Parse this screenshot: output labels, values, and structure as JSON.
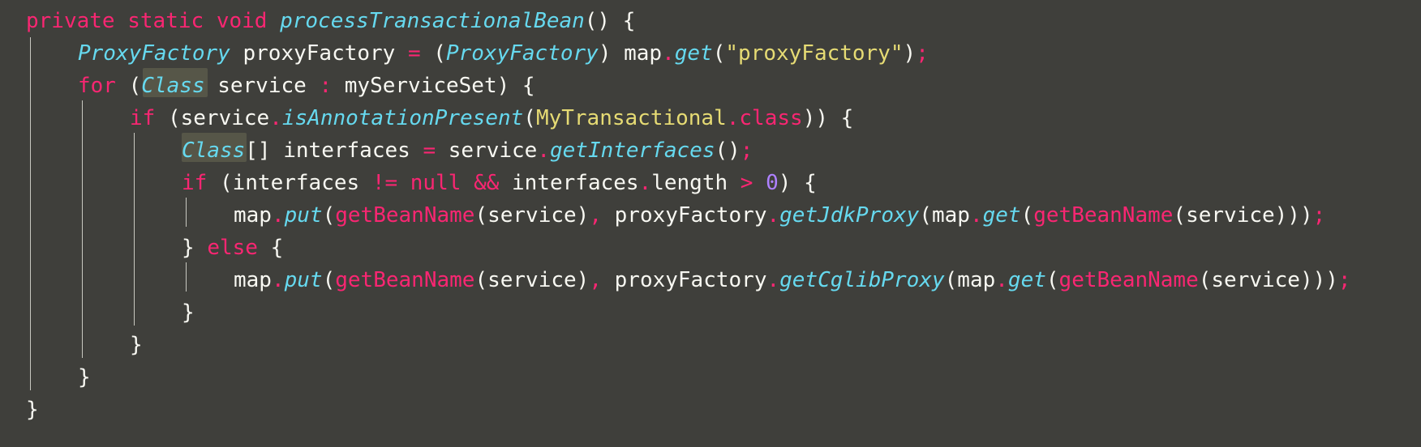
{
  "code_lines": [
    [
      {
        "t": "private",
        "c": "kw"
      },
      {
        "t": " ",
        "c": "pl"
      },
      {
        "t": "static",
        "c": "kw"
      },
      {
        "t": " ",
        "c": "pl"
      },
      {
        "t": "void",
        "c": "kw"
      },
      {
        "t": " ",
        "c": "pl"
      },
      {
        "t": "processTransactionalBean",
        "c": "fn"
      },
      {
        "t": "() {",
        "c": "pl"
      }
    ],
    [
      {
        "t": "ProxyFactory",
        "c": "ty"
      },
      {
        "t": " proxyFactory ",
        "c": "pl"
      },
      {
        "t": "=",
        "c": "op"
      },
      {
        "t": " (",
        "c": "pl"
      },
      {
        "t": "ProxyFactory",
        "c": "ty"
      },
      {
        "t": ") map",
        "c": "pl"
      },
      {
        "t": ".",
        "c": "op"
      },
      {
        "t": "get",
        "c": "fn"
      },
      {
        "t": "(",
        "c": "pl"
      },
      {
        "t": "\"proxyFactory\"",
        "c": "st"
      },
      {
        "t": ")",
        "c": "pl"
      },
      {
        "t": ";",
        "c": "op"
      }
    ],
    [
      {
        "t": "for",
        "c": "kw"
      },
      {
        "t": " (",
        "c": "pl"
      },
      {
        "t": "Class",
        "c": "ty"
      },
      {
        "t": " service ",
        "c": "pl"
      },
      {
        "t": ":",
        "c": "op"
      },
      {
        "t": " myServiceSet) {",
        "c": "pl"
      }
    ],
    [
      {
        "t": "if",
        "c": "kw"
      },
      {
        "t": " (service",
        "c": "pl"
      },
      {
        "t": ".",
        "c": "op"
      },
      {
        "t": "isAnnotationPresent",
        "c": "fn"
      },
      {
        "t": "(",
        "c": "pl"
      },
      {
        "t": "MyTransactional",
        "c": "cl"
      },
      {
        "t": ".",
        "c": "op"
      },
      {
        "t": "class",
        "c": "kw"
      },
      {
        "t": ")) {",
        "c": "pl"
      }
    ],
    [
      {
        "t": "Class",
        "c": "ty"
      },
      {
        "t": "[] interfaces ",
        "c": "pl"
      },
      {
        "t": "=",
        "c": "op"
      },
      {
        "t": " service",
        "c": "pl"
      },
      {
        "t": ".",
        "c": "op"
      },
      {
        "t": "getInterfaces",
        "c": "fn"
      },
      {
        "t": "()",
        "c": "pl"
      },
      {
        "t": ";",
        "c": "op"
      }
    ],
    [
      {
        "t": "if",
        "c": "kw"
      },
      {
        "t": " (interfaces ",
        "c": "pl"
      },
      {
        "t": "!=",
        "c": "op"
      },
      {
        "t": " ",
        "c": "pl"
      },
      {
        "t": "null",
        "c": "kw"
      },
      {
        "t": " ",
        "c": "pl"
      },
      {
        "t": "&&",
        "c": "op"
      },
      {
        "t": " interfaces",
        "c": "pl"
      },
      {
        "t": ".",
        "c": "op"
      },
      {
        "t": "length ",
        "c": "pl"
      },
      {
        "t": ">",
        "c": "op"
      },
      {
        "t": " ",
        "c": "pl"
      },
      {
        "t": "0",
        "c": "nm"
      },
      {
        "t": ") {",
        "c": "pl"
      }
    ],
    [
      {
        "t": "map",
        "c": "pl"
      },
      {
        "t": ".",
        "c": "op"
      },
      {
        "t": "put",
        "c": "fn"
      },
      {
        "t": "(",
        "c": "pl"
      },
      {
        "t": "getBeanName",
        "c": "kw"
      },
      {
        "t": "(service)",
        "c": "pl"
      },
      {
        "t": ",",
        "c": "op"
      },
      {
        "t": " proxyFactory",
        "c": "pl"
      },
      {
        "t": ".",
        "c": "op"
      },
      {
        "t": "getJdkProxy",
        "c": "fn"
      },
      {
        "t": "(map",
        "c": "pl"
      },
      {
        "t": ".",
        "c": "op"
      },
      {
        "t": "get",
        "c": "fn"
      },
      {
        "t": "(",
        "c": "pl"
      },
      {
        "t": "getBeanName",
        "c": "kw"
      },
      {
        "t": "(service)))",
        "c": "pl"
      },
      {
        "t": ";",
        "c": "op"
      }
    ],
    [
      {
        "t": "} ",
        "c": "pl"
      },
      {
        "t": "else",
        "c": "kw"
      },
      {
        "t": " {",
        "c": "pl"
      }
    ],
    [
      {
        "t": "map",
        "c": "pl"
      },
      {
        "t": ".",
        "c": "op"
      },
      {
        "t": "put",
        "c": "fn"
      },
      {
        "t": "(",
        "c": "pl"
      },
      {
        "t": "getBeanName",
        "c": "kw"
      },
      {
        "t": "(service)",
        "c": "pl"
      },
      {
        "t": ",",
        "c": "op"
      },
      {
        "t": " proxyFactory",
        "c": "pl"
      },
      {
        "t": ".",
        "c": "op"
      },
      {
        "t": "getCglibProxy",
        "c": "fn"
      },
      {
        "t": "(map",
        "c": "pl"
      },
      {
        "t": ".",
        "c": "op"
      },
      {
        "t": "get",
        "c": "fn"
      },
      {
        "t": "(",
        "c": "pl"
      },
      {
        "t": "getBeanName",
        "c": "kw"
      },
      {
        "t": "(service)))",
        "c": "pl"
      },
      {
        "t": ";",
        "c": "op"
      }
    ],
    [
      {
        "t": "}",
        "c": "pl"
      }
    ],
    [
      {
        "t": "}",
        "c": "pl"
      }
    ],
    [
      {
        "t": "}",
        "c": "pl"
      }
    ],
    [
      {
        "t": "}",
        "c": "pl"
      }
    ]
  ],
  "colors": {
    "background": "#3f3f3b",
    "keyword": "#f92672",
    "function": "#66d9ef",
    "string": "#e6db74",
    "number": "#ae81ff",
    "plain": "#f8f8f2"
  }
}
